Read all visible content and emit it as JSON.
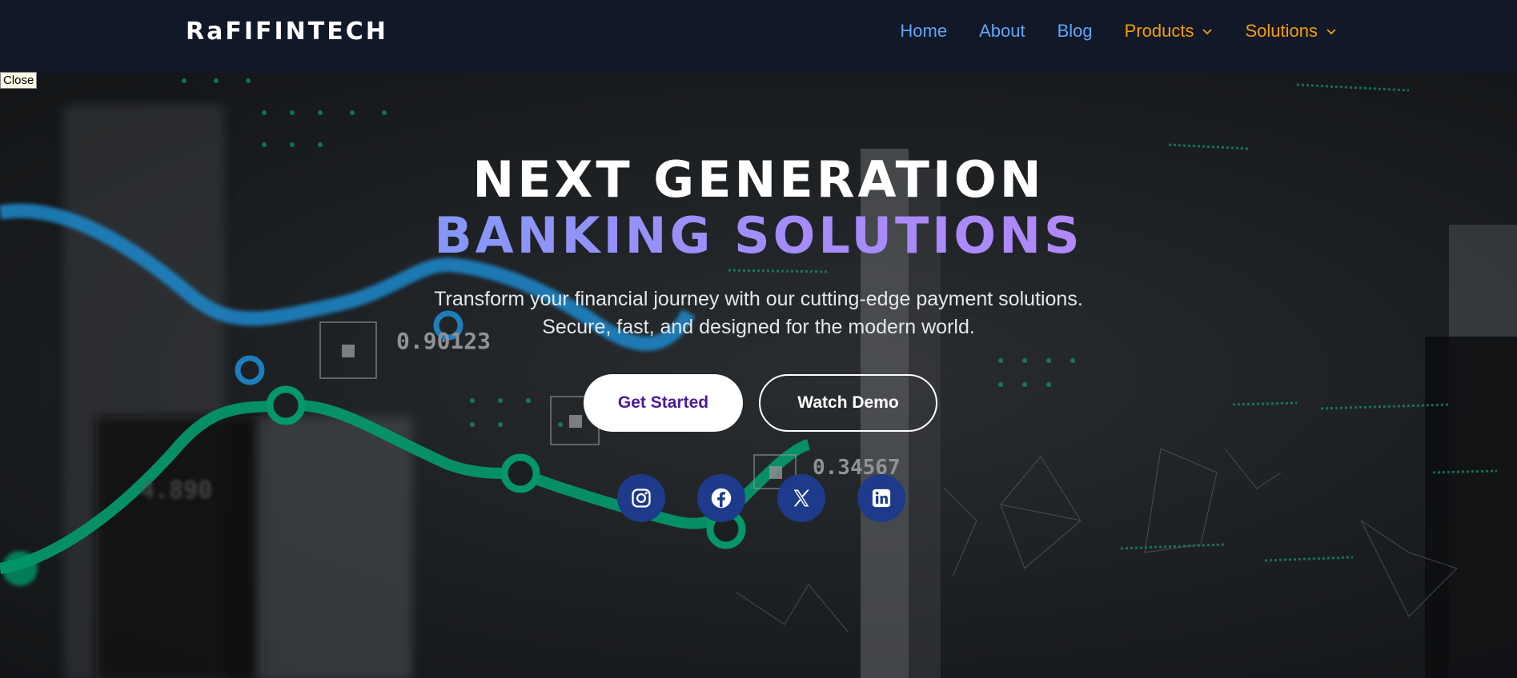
{
  "header": {
    "logo": "RaFIFINTECH",
    "nav": [
      {
        "label": "Home",
        "color": "#60a5fa"
      },
      {
        "label": "About",
        "color": "#60a5fa"
      },
      {
        "label": "Blog",
        "color": "#60a5fa"
      },
      {
        "label": "Products",
        "color": "#f59e0b",
        "dropdown": true
      },
      {
        "label": "Solutions",
        "color": "#f59e0b",
        "dropdown": true
      }
    ]
  },
  "close_label": "Close",
  "hero": {
    "title_line1": "NEXT GENERATION",
    "title_line2": "BANKING SOLUTIONS",
    "subtitle_line1": "Transform your financial journey with our cutting-edge payment solutions.",
    "subtitle_line2": "Secure, fast, and designed for the modern world.",
    "primary_button": "Get Started",
    "secondary_button": "Watch Demo",
    "social": [
      "instagram-icon",
      "facebook-icon",
      "x-icon",
      "linkedin-icon"
    ],
    "bg_numbers": [
      "0.90123",
      "0.34567",
      "4.890"
    ]
  },
  "colors": {
    "nav_bg": "#111827",
    "accent_blue": "#60a5fa",
    "accent_purple": "#c084fc",
    "accent_orange": "#f59e0b",
    "social_bg": "#1e3a8a",
    "primary_text": "#4c1d95"
  }
}
